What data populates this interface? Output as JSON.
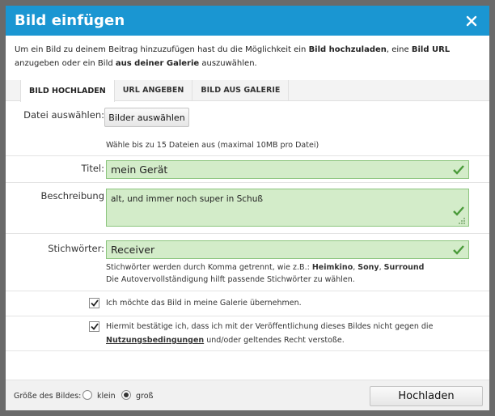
{
  "title": "Bild einfügen",
  "intro": {
    "t1": "Um ein Bild zu deinem Beitrag hinzuzufügen hast du die Möglichkeit ein ",
    "b1": "Bild hochzuladen",
    "t2": ", eine ",
    "b2": "Bild URL",
    "t3": " anzugeben oder ein Bild ",
    "b3": "aus deiner Galerie",
    "t4": " auszuwählen."
  },
  "tabs": [
    "BILD HOCHLADEN",
    "URL ANGEBEN",
    "BILD AUS GALERIE"
  ],
  "file": {
    "label": "Datei auswählen:",
    "button": "Bilder auswählen",
    "hint": "Wähle bis zu 15 Dateien aus (maximal 10MB pro Datei)"
  },
  "titel": {
    "label": "Titel:",
    "value": "mein Gerät"
  },
  "beschreibung": {
    "label": "Beschreibung",
    "value": "alt, und immer noch super in Schuß"
  },
  "stichwoerter": {
    "label": "Stichwörter:",
    "value": "Receiver",
    "hint1": "Stichwörter werden durch Komma getrennt, wie z.B.: ",
    "ex1": "Heimkino",
    "sep1": ", ",
    "ex2": "Sony",
    "sep2": ", ",
    "ex3": "Surround",
    "hint2": "Die Autovervollständigung hilft passende Stichwörter zu wählen."
  },
  "checkbox1": {
    "checked": true,
    "text": "Ich möchte das Bild in meine Galerie übernehmen."
  },
  "checkbox2": {
    "checked": true,
    "t1": "Hiermit bestätige ich, dass ich mit der Veröffentlichung dieses Bildes nicht gegen die",
    "link": "Nutzungsbedingungen",
    "t2": " und/oder geltendes Recht verstoße."
  },
  "footer": {
    "size_label": "Größe des Bildes:",
    "options": [
      "klein",
      "groß"
    ],
    "selected": "groß",
    "upload_button": "Hochladen"
  },
  "colors": {
    "titlebar": "#1a96d2",
    "field_bg": "#d3ecc9",
    "field_border": "#8cc57e",
    "check": "#4a9a3a"
  }
}
